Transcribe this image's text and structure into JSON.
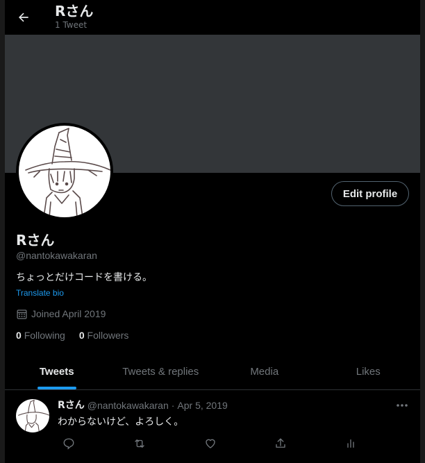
{
  "header": {
    "title": "Rさん",
    "subtitle": "1 Tweet"
  },
  "profile": {
    "name": "Rさん",
    "handle": "@nantokawakaran",
    "bio": "ちょっとだけコードを書ける。",
    "translate_label": "Translate bio",
    "joined": "Joined April 2019",
    "following_count": "0",
    "following_label": "Following",
    "followers_count": "0",
    "followers_label": "Followers",
    "edit_label": "Edit profile"
  },
  "tabs": [
    {
      "label": "Tweets",
      "active": true
    },
    {
      "label": "Tweets & replies",
      "active": false
    },
    {
      "label": "Media",
      "active": false
    },
    {
      "label": "Likes",
      "active": false
    }
  ],
  "tweet": {
    "name": "Rさん",
    "handle": "@nantokawakaran",
    "separator": "·",
    "date": "Apr 5, 2019",
    "text": "わからないけど、よろしく。",
    "more_glyph": "···"
  },
  "colors": {
    "background": "#000000",
    "banner": "#333639",
    "accent": "#1d9bf0",
    "text_primary": "#e7e9ea",
    "text_secondary": "#71767b"
  },
  "icons": [
    "arrow-left-icon",
    "calendar-icon",
    "more-icon",
    "reply-icon",
    "retweet-icon",
    "like-icon",
    "share-icon",
    "analytics-icon"
  ]
}
